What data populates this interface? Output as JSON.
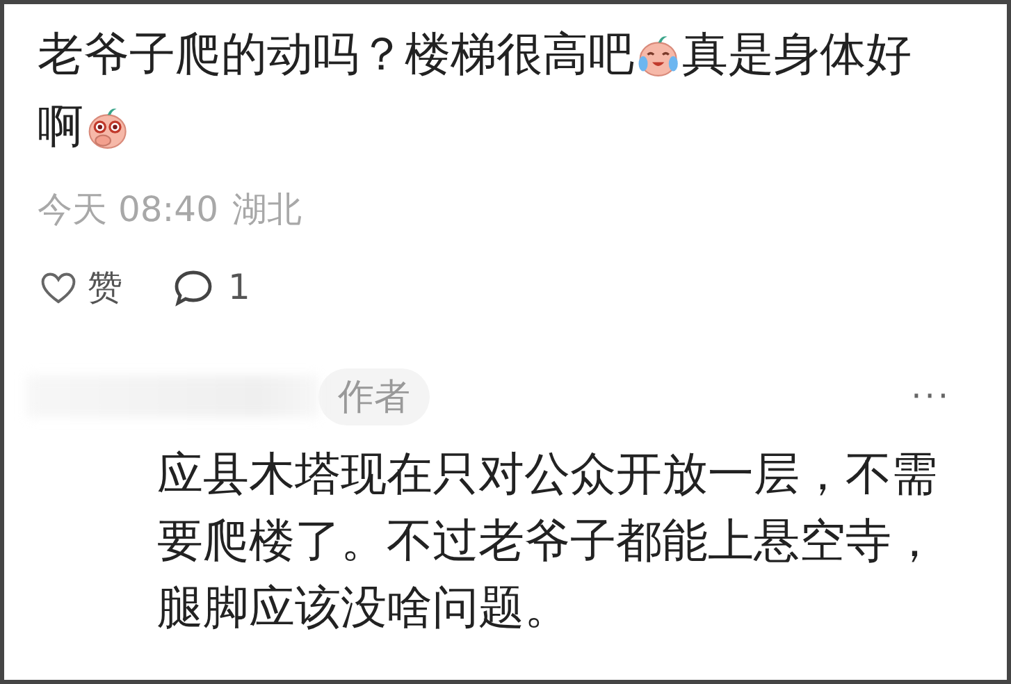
{
  "comment": {
    "lines": [
      [
        {
          "kind": "text",
          "text": "老爷子爬的动吗？楼梯很高吧"
        },
        {
          "kind": "crying"
        },
        {
          "kind": "text",
          "text": "真是身体好"
        }
      ],
      [
        {
          "kind": "text",
          "text": "啊"
        },
        {
          "kind": "covering"
        }
      ]
    ],
    "time": "今天 08:40",
    "location": "湖北",
    "like_label": "赞",
    "liked": false,
    "reply_count": "1"
  },
  "reply": {
    "badge": "作者",
    "more": "···",
    "text": "应县木塔现在只对公众开放一层，不需要爬楼了。不过老爷子都能上悬空寺，腿脚应该没啥问题。"
  }
}
